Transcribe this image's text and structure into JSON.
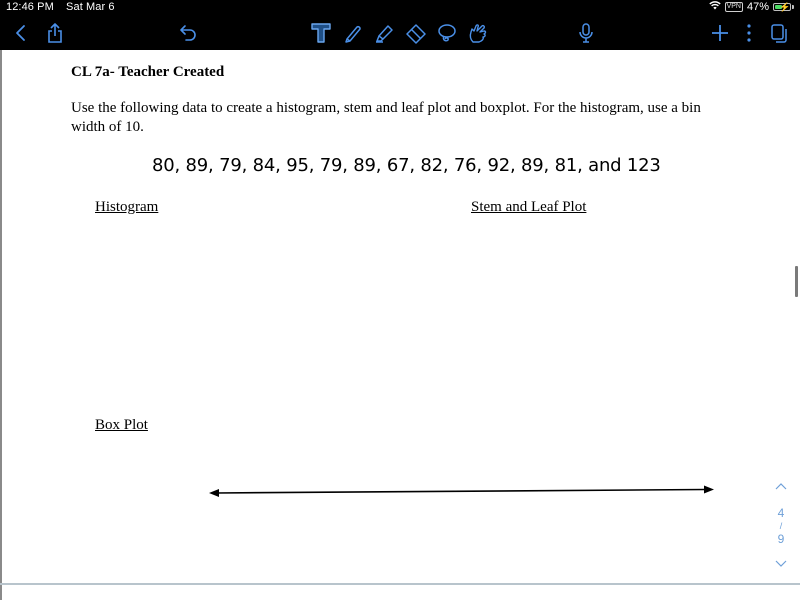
{
  "status_bar": {
    "time": "12:46 PM",
    "date": "Sat Mar 6",
    "vpn_label": "VPN",
    "battery_percent": "47%",
    "battery_level": 0.47,
    "charging": true
  },
  "toolbar": {
    "accent_color": "#4a8fe7",
    "left_tools": [
      {
        "name": "back",
        "icon": "chevron-left-icon"
      },
      {
        "name": "share",
        "icon": "share-icon"
      },
      {
        "name": "undo",
        "icon": "undo-icon"
      }
    ],
    "drawing_tools": [
      {
        "name": "text",
        "icon": "text-tool-icon",
        "selected": true
      },
      {
        "name": "pen",
        "icon": "pen-icon"
      },
      {
        "name": "highlighter",
        "icon": "highlighter-icon"
      },
      {
        "name": "eraser",
        "icon": "eraser-icon"
      },
      {
        "name": "lasso",
        "icon": "lasso-icon"
      },
      {
        "name": "hand",
        "icon": "hand-pointer-icon"
      }
    ],
    "right_tools": [
      {
        "name": "microphone",
        "icon": "microphone-icon"
      },
      {
        "name": "add",
        "icon": "plus-icon"
      },
      {
        "name": "more",
        "icon": "more-vertical-icon"
      },
      {
        "name": "pages",
        "icon": "pages-icon"
      }
    ]
  },
  "document": {
    "title": "CL 7a- Teacher Created",
    "instructions": "Use the following data to create a histogram, stem and leaf plot and boxplot. For the histogram, use a bin width of 10.",
    "data_values": [
      80,
      89,
      79,
      84,
      95,
      79,
      89,
      67,
      82,
      76,
      92,
      89,
      81,
      123
    ],
    "data_line": "80, 89, 79, 84, 95, 79, 89, 67, 82, 76, 92, 89, 81, and 123",
    "sections": {
      "histogram": "Histogram",
      "stem_leaf": "Stem and Leaf Plot",
      "box_plot": "Box Plot"
    }
  },
  "pager": {
    "current_page": "4",
    "separator": "/",
    "total_pages": "9",
    "color": "#6fa0d8"
  }
}
